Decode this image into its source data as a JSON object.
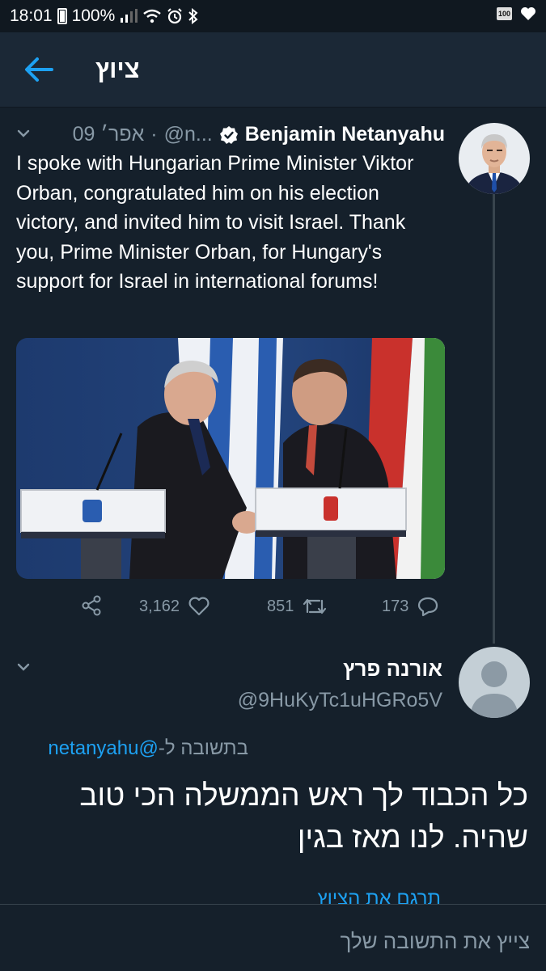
{
  "status_bar": {
    "time": "18:01",
    "battery_percent": "100%",
    "battery_badge": "100"
  },
  "header": {
    "title": "ציוץ"
  },
  "tweet": {
    "author_name": "Benjamin Netanyahu",
    "author_handle": "@n...",
    "separator": "·",
    "date": "09 אפר׳",
    "text": "I spoke with Hungarian Prime Minister Viktor Orban, congratulated him on his election victory, and invited him to visit Israel. Thank you, Prime Minister Orban, for Hungary's support for Israel in international forums!",
    "image_alt": "Netanyahu and Orban shaking hands between podiums in front of Israeli and Hungarian flags",
    "likes": "3,162",
    "retweets": "851",
    "replies": "173"
  },
  "reply": {
    "author_name": "אורנה פרץ",
    "author_handle": "@9HuKyTc1uHGRo5V",
    "replying_prefix": "בתשובה ל-",
    "replying_handle": "@netanyahu",
    "text": "כל הכבוד לך ראש הממשלה הכי טוב שהיה. לנו מאז בגין",
    "translate_label": "תרגם את הציוץ"
  },
  "compose": {
    "placeholder": "צייץ את התשובה שלך"
  },
  "colors": {
    "background": "#15202b",
    "accent": "#1da1f2",
    "muted": "#8899a6"
  },
  "icons": [
    "back-arrow-icon",
    "verified-badge-icon",
    "chevron-down-icon",
    "share-icon",
    "heart-icon",
    "retweet-icon",
    "reply-icon",
    "default-avatar-icon"
  ]
}
